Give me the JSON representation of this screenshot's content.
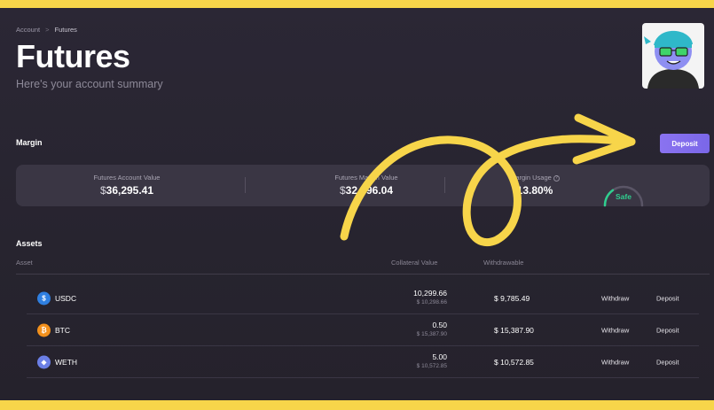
{
  "breadcrumb": {
    "root": "Account",
    "separator": ">",
    "current": "Futures"
  },
  "header": {
    "title": "Futures",
    "subtitle": "Here's your account summary"
  },
  "margin": {
    "label": "Margin",
    "deposit_label": "Deposit",
    "account_value_label": "Futures Account Value",
    "account_value_currency": "$",
    "account_value": "36,295.41",
    "margin_value_label": "Futures Margin Value",
    "margin_value_currency": "$",
    "margin_value": "32,396.04",
    "usage_label": "Margin Usage",
    "usage_value": "13.80%",
    "usage_fraction": 0.138,
    "safety_status": "Safe"
  },
  "assets": {
    "label": "Assets",
    "columns": {
      "asset": "Asset",
      "collateral": "Collateral Value",
      "withdrawable": "Withdrawable"
    },
    "rows": [
      {
        "symbol": "USDC",
        "icon": "usdc-icon",
        "icon_glyph": "$",
        "icon_color": "#2f7fe0",
        "collateral": "10,299.66",
        "collateral_usd": "$ 10,298.66",
        "withdrawable": "$ 9,785.49",
        "withdraw_label": "Withdraw",
        "deposit_label": "Deposit"
      },
      {
        "symbol": "BTC",
        "icon": "btc-icon",
        "icon_glyph": "₿",
        "icon_color": "#f2901c",
        "collateral": "0.50",
        "collateral_usd": "$ 15,387.90",
        "withdrawable": "$ 15,387.90",
        "withdraw_label": "Withdraw",
        "deposit_label": "Deposit"
      },
      {
        "symbol": "WETH",
        "icon": "weth-icon",
        "icon_glyph": "◆",
        "icon_color": "#6b7fe6",
        "collateral": "5.00",
        "collateral_usd": "$ 10,572.85",
        "withdrawable": "$ 10,572.85",
        "withdraw_label": "Withdraw",
        "deposit_label": "Deposit"
      }
    ]
  },
  "colors": {
    "frame": "#f7d54a",
    "background": "#2a2633",
    "card": "#3a3644",
    "accent": "#7c69ea",
    "safe": "#2fcf8f",
    "annotation": "#f7d54a"
  }
}
